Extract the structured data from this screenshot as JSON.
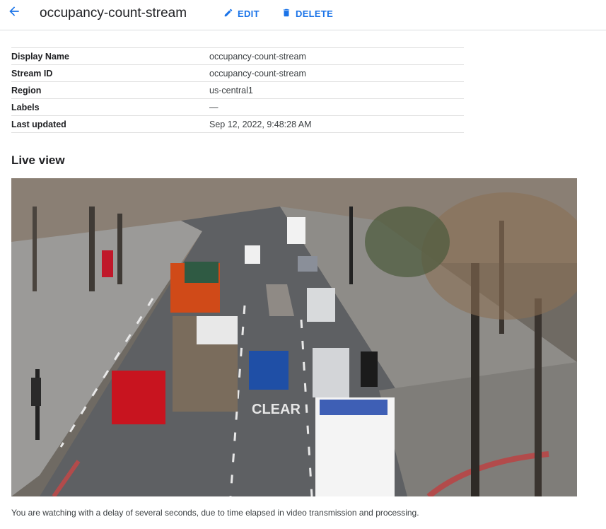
{
  "header": {
    "title": "occupancy-count-stream",
    "edit_label": "EDIT",
    "delete_label": "DELETE"
  },
  "details": [
    {
      "key": "Display Name",
      "value": "occupancy-count-stream"
    },
    {
      "key": "Stream ID",
      "value": "occupancy-count-stream"
    },
    {
      "key": "Region",
      "value": "us-central1"
    },
    {
      "key": "Labels",
      "value": "—"
    },
    {
      "key": "Last updated",
      "value": "Sep 12, 2022, 9:48:28 AM"
    }
  ],
  "live_view": {
    "title": "Live view",
    "road_marking": "CLEAR",
    "caption": "You are watching with a delay of several seconds, due to time elapsed in video transmission and processing."
  },
  "colors": {
    "accent": "#1a73e8",
    "divider": "#e0e0e0",
    "text": "#202124"
  }
}
